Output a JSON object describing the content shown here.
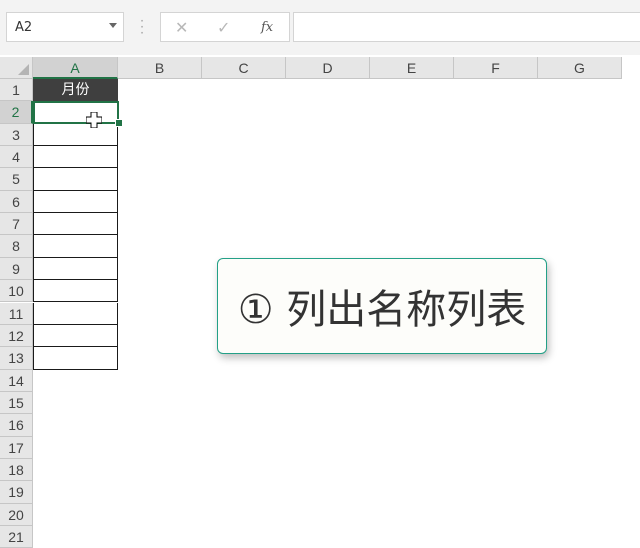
{
  "formula_bar": {
    "name_box": "A2",
    "cancel_icon": "x-icon",
    "enter_icon": "check-icon",
    "fx_label": "fx",
    "formula_value": ""
  },
  "columns": [
    "A",
    "B",
    "C",
    "D",
    "E",
    "F",
    "G"
  ],
  "rows": [
    "1",
    "2",
    "3",
    "4",
    "5",
    "6",
    "7",
    "8",
    "9",
    "10",
    "11",
    "12",
    "13",
    "14",
    "15",
    "16",
    "17",
    "18",
    "19",
    "20",
    "21"
  ],
  "table": {
    "header": "月份",
    "cells": [
      "",
      "",
      "",
      "",
      "",
      "",
      "",
      "",
      "",
      "",
      "",
      ""
    ]
  },
  "selection": {
    "active_cell": "A2"
  },
  "callout": {
    "text": "① 列出名称列表",
    "border_color": "#23a087"
  },
  "colors": {
    "excel_green": "#217346",
    "header_fill": "#3f3f3f"
  }
}
